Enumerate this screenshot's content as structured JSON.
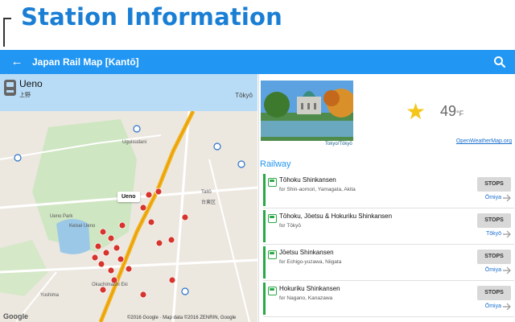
{
  "banner": {
    "title": "Station Information"
  },
  "appbar": {
    "title": "Japan Rail Map [Kantō]",
    "back_icon": "arrow-left-icon",
    "search_icon": "search-icon"
  },
  "station": {
    "name": "Ueno",
    "kanji": "上野",
    "region": "Tōkyō"
  },
  "map": {
    "copyright": "©2016 Google · Map data ©2016 ZENRIN, Google",
    "provider": "Google",
    "callout": "Ueno",
    "labels": {
      "uguisudani": "Uguisudani",
      "taito": "Taitō",
      "taito_kanji": "台東区",
      "ueno_park": "Ueno Park",
      "okachimachi": "Okachimachi Eki",
      "keisei_ueno": "Keisei Ueno",
      "yushima": "Yushima"
    }
  },
  "weather": {
    "icon": "star-icon",
    "temperature": "49",
    "unit": "°F",
    "source_link": "OpenWeatherMap.org",
    "photo_caption": "Tokyo/Tōkyō"
  },
  "railway": {
    "section_title": "Railway",
    "stops_label": "STOPS",
    "accent_color": "#2aa845",
    "lines": [
      {
        "name": "Tōhoku Shinkansen",
        "dest": "for Shin-aomori, Yamagata, Akita",
        "next": "Ōmiya"
      },
      {
        "name": "Tōhoku, Jōetsu & Hokuriku Shinkansen",
        "dest": "for Tōkyō",
        "next": "Tōkyō"
      },
      {
        "name": "Jōetsu Shinkansen",
        "dest": "for Echigo-yuzawa, Niigata",
        "next": "Ōmiya"
      },
      {
        "name": "Hokuriku Shinkansen",
        "dest": "for Nagano, Kanazawa",
        "next": "Ōmiya"
      }
    ]
  }
}
